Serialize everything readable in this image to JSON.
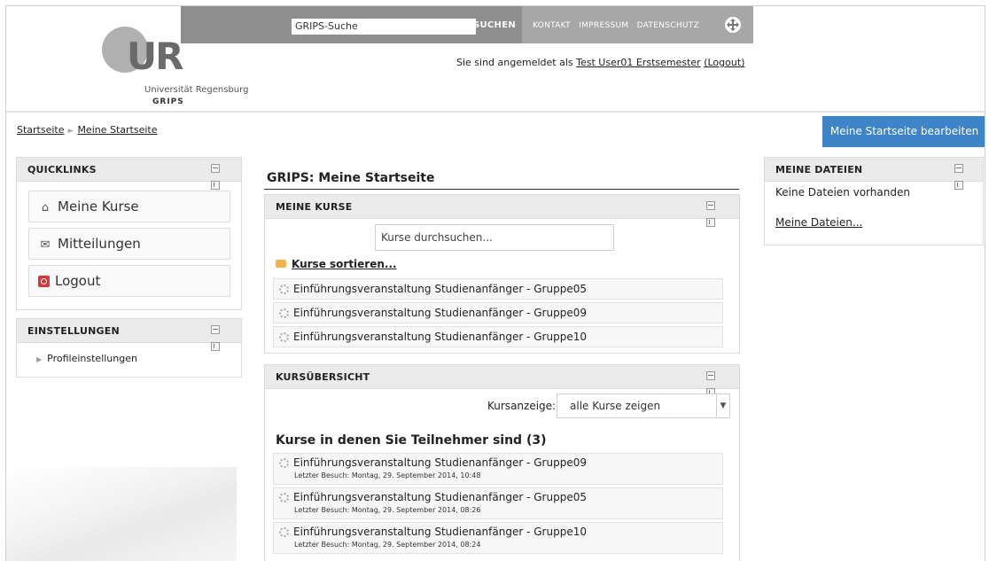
{
  "header": {
    "logo_text": "UR",
    "university": "Universität Regensburg",
    "system": "GRIPS",
    "search_placeholder": "GRIPS-Suche",
    "search_button": "SUCHEN",
    "links": [
      "KONTAKT",
      "IMPRESSUM",
      "DATENSCHUTZ"
    ],
    "login_prefix": "Sie sind angemeldet als",
    "user_name": "Test User01 Erstsemester",
    "logout_label": "(Logout)"
  },
  "breadcrumb": {
    "home": "Startseite",
    "separator": "►",
    "current": "Meine Startseite"
  },
  "edit_button": "Meine Startseite bearbeiten",
  "quicklinks": {
    "title": "QUICKLINKS",
    "items": [
      {
        "label": "Meine Kurse",
        "icon": "courses-icon"
      },
      {
        "label": "Mitteilungen",
        "icon": "messages-icon"
      },
      {
        "label": "Logout",
        "icon": "logout-icon"
      }
    ]
  },
  "einstellungen": {
    "title": "EINSTELLUNGEN",
    "items": [
      "Profileinstellungen"
    ]
  },
  "main": {
    "page_title": "GRIPS: Meine Startseite",
    "meine_kurse": {
      "title": "MEINE KURSE",
      "search_placeholder": "Kurse durchsuchen...",
      "sort_link": "Kurse sortieren...",
      "courses": [
        "Einführungsveranstaltung Studienanfänger - Gruppe05",
        "Einführungsveranstaltung Studienanfänger - Gruppe09",
        "Einführungsveranstaltung Studienanfänger - Gruppe10"
      ]
    },
    "kursuebersicht": {
      "title": "KURSÜBERSICHT",
      "filter_label": "Kursanzeige:",
      "filter_value": "alle Kurse zeigen",
      "heading": "Kurse in denen Sie Teilnehmer sind (3)",
      "courses": [
        {
          "name": "Einführungsveranstaltung Studienanfänger - Gruppe09",
          "last_visit": "Letzter Besuch: Montag, 29. September 2014, 10:48"
        },
        {
          "name": "Einführungsveranstaltung Studienanfänger - Gruppe05",
          "last_visit": "Letzter Besuch: Montag, 29. September 2014, 08:26"
        },
        {
          "name": "Einführungsveranstaltung Studienanfänger - Gruppe10",
          "last_visit": "Letzter Besuch: Montag, 29. September 2014, 08:24"
        }
      ]
    }
  },
  "meine_dateien": {
    "title": "MEINE DATEIEN",
    "empty_text": "Keine Dateien vorhanden",
    "link": "Meine Dateien..."
  },
  "colors": {
    "accent": "#3d85c6",
    "topbar": "#8e8e8e",
    "block_header": "#ebebeb"
  }
}
